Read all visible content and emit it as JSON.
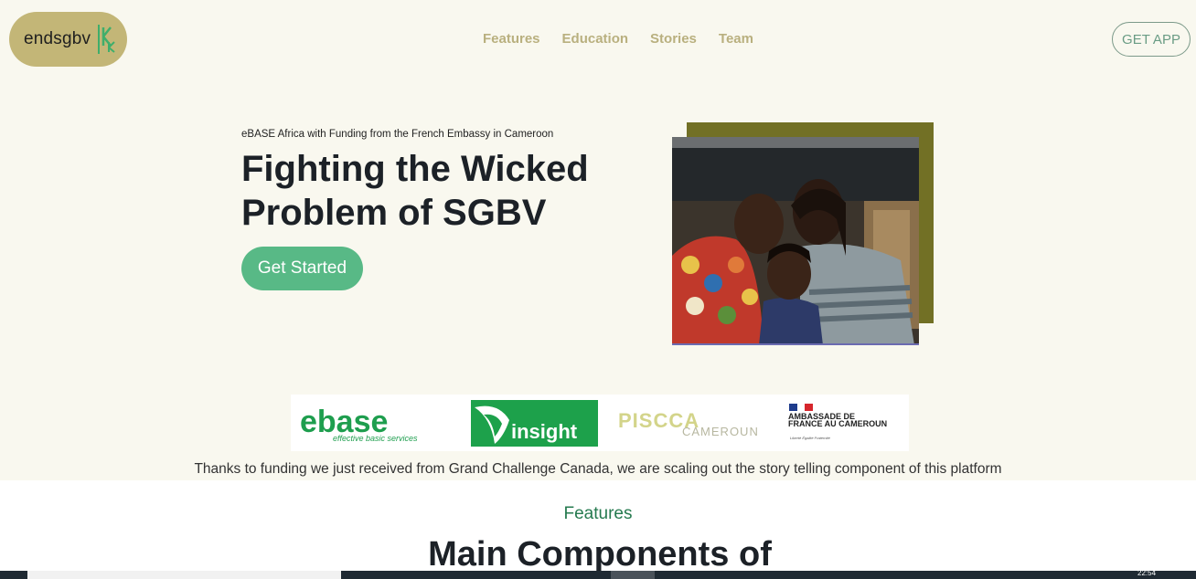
{
  "brand": {
    "name": "endsgbv",
    "accent": "#58b986",
    "pill_color": "#c3b677"
  },
  "nav": {
    "items": [
      "Features",
      "Education",
      "Stories",
      "Team"
    ]
  },
  "header": {
    "get_app_label": "GET APP"
  },
  "hero": {
    "kicker": "eBASE Africa with Funding from the French Embassy in Cameroon",
    "title": "Fighting the Wicked Problem of SGBV",
    "cta_label": "Get Started"
  },
  "partners": {
    "ebase_name": "ebase",
    "ebase_tagline": "effective basic services",
    "insight_name": "insight",
    "piscca_name": "PISCCA",
    "piscca_sub": "CAMEROUN",
    "embassy_name": "AMBASSADE DE FRANCE AU CAMEROUN",
    "embassy_motto": "Liberté Égalité Fraternité"
  },
  "thanks_text": "Thanks to funding we just received from Grand Challenge Canada, we are scaling out the story telling component of this platform",
  "features": {
    "label": "Features",
    "title": "Main Components of"
  },
  "taskbar": {
    "clock": "22:54"
  }
}
